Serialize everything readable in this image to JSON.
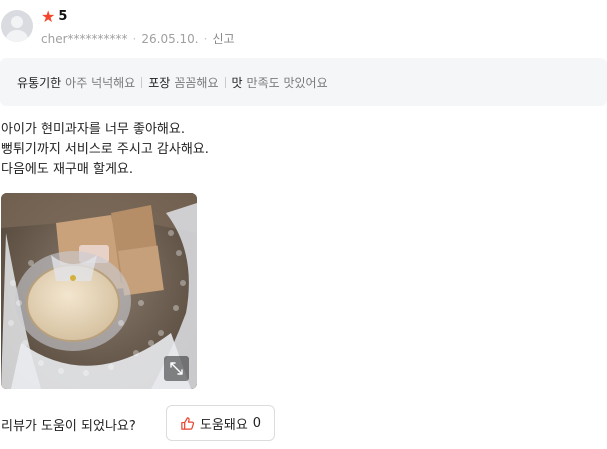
{
  "review": {
    "rating_value": "5",
    "rating_max": 5,
    "star_color": "#f5462d",
    "author": "cher**********",
    "date": "26.05.10.",
    "report_label": "신고",
    "tags": [
      {
        "key": "유통기한",
        "value": "아주 넉넉해요"
      },
      {
        "key": "포장",
        "value": "꼼꼼해요"
      },
      {
        "key": "맛",
        "value": "만족도 맛있어요"
      }
    ],
    "lines": [
      "아이가 현미과자를 너무 좋아해요.",
      "뻥튀기까지 서비스로 주시고 감사해요.",
      "다음에도 재구매 할게요."
    ],
    "photo_icon": "expand-icon"
  },
  "helpful": {
    "question": "리뷰가 도움이 되었나요?",
    "button_label": "도움돼요",
    "count": "0",
    "icon": "thumbs-up-icon",
    "icon_color": "#e8442f"
  }
}
